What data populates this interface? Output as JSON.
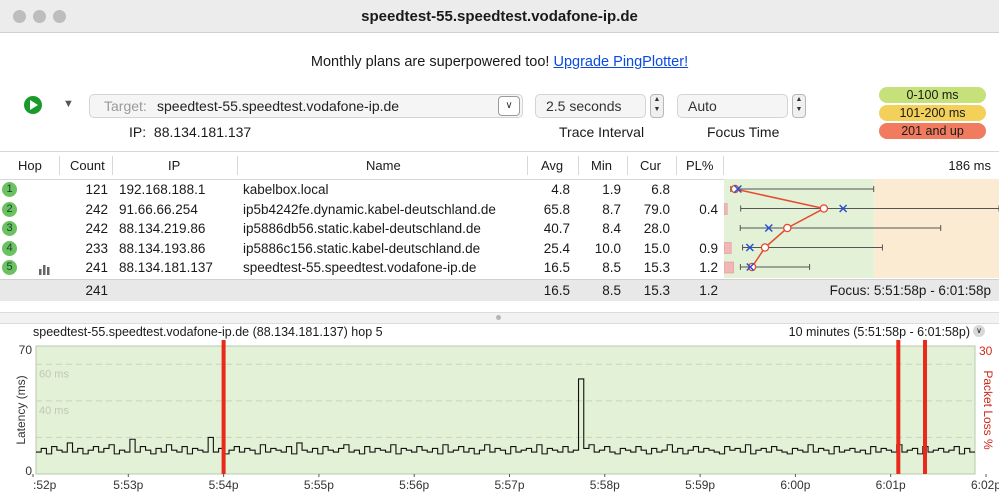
{
  "window": {
    "title": "speedtest-55.speedtest.vodafone-ip.de"
  },
  "promo": {
    "text": "Monthly plans are superpowered too!",
    "link": "Upgrade PingPlotter!"
  },
  "toolbar": {
    "target_label": "Target:",
    "target_value": "speedtest-55.speedtest.vodafone-ip.de",
    "ip_label": "IP:",
    "ip_value": "88.134.181.137",
    "trace_interval_value": "2.5 seconds",
    "trace_interval_label": "Trace Interval",
    "focus_time_value": "Auto",
    "focus_time_label": "Focus Time"
  },
  "legend": [
    {
      "label": "0-100 ms",
      "color": "#c6e07a"
    },
    {
      "label": "101-200 ms",
      "color": "#f3d05a"
    },
    {
      "label": "201 and up",
      "color": "#f07b5e"
    }
  ],
  "table": {
    "headers": {
      "hop": "Hop",
      "count": "Count",
      "ip": "IP",
      "name": "Name",
      "avg": "Avg",
      "min": "Min",
      "cur": "Cur",
      "pl": "PL%",
      "scale": "186 ms"
    },
    "rows": [
      {
        "hop": "1",
        "count": "121",
        "ip": "192.168.188.1",
        "name": "kabelbox.local",
        "avg": "4.8",
        "min": "1.9",
        "cur": "6.8",
        "pl": "",
        "min_ms": 1.9,
        "avg_ms": 4.8,
        "cur_ms": 6.8,
        "max_ms": 100,
        "pl_value": 0
      },
      {
        "hop": "2",
        "count": "242",
        "ip": "91.66.66.254",
        "name": "ip5b4242fe.dynamic.kabel-deutschland.de",
        "avg": "65.8",
        "min": "8.7",
        "cur": "79.0",
        "pl": "0.4",
        "min_ms": 8.7,
        "avg_ms": 65.8,
        "cur_ms": 79.0,
        "max_ms": 186,
        "pl_value": 0.4
      },
      {
        "hop": "3",
        "count": "242",
        "ip": "88.134.219.86",
        "name": "ip5886db56.static.kabel-deutschland.de",
        "avg": "40.7",
        "min": "8.4",
        "cur": "28.0",
        "pl": "",
        "min_ms": 8.4,
        "avg_ms": 40.7,
        "cur_ms": 28.0,
        "max_ms": 146,
        "pl_value": 0
      },
      {
        "hop": "4",
        "count": "233",
        "ip": "88.134.193.86",
        "name": "ip5886c156.static.kabel-deutschland.de",
        "avg": "25.4",
        "min": "10.0",
        "cur": "15.0",
        "pl": "0.9",
        "min_ms": 10.0,
        "avg_ms": 25.4,
        "cur_ms": 15.0,
        "max_ms": 106,
        "pl_value": 0.9
      },
      {
        "hop": "5",
        "count": "241",
        "ip": "88.134.181.137",
        "name": "speedtest-55.speedtest.vodafone-ip.de",
        "avg": "16.5",
        "min": "8.5",
        "cur": "15.3",
        "pl": "1.2",
        "min_ms": 8.5,
        "avg_ms": 16.5,
        "cur_ms": 15.3,
        "max_ms": 56,
        "pl_value": 1.2
      }
    ],
    "summary": {
      "count": "241",
      "avg": "16.5",
      "min": "8.5",
      "cur": "15.3",
      "pl": "1.2",
      "focus": "Focus: 5:51:58p - 6:01:58p"
    }
  },
  "graph": {
    "title": "speedtest-55.speedtest.vodafone-ip.de (88.134.181.137) hop 5",
    "range": "10 minutes (5:51:58p - 6:01:58p)",
    "chart_data": {
      "type": "line",
      "ylabel": "Latency (ms)",
      "y2label": "Packet Loss %",
      "ylim": [
        0,
        70
      ],
      "y2lim": [
        0,
        30
      ],
      "y_ticks": [
        "70",
        "0"
      ],
      "y2_ticks": [
        "30"
      ],
      "gridlines": [
        "60 ms",
        "40 ms"
      ],
      "x_ticks": [
        ":52p",
        "5:53p",
        "5:54p",
        "5:55p",
        "5:56p",
        "5:57p",
        "5:58p",
        "5:59p",
        "6:00p",
        "6:01p",
        "6:02p"
      ],
      "series": [
        {
          "values": [
            12,
            14,
            11,
            15,
            13,
            12,
            17,
            12,
            14,
            11,
            13,
            15,
            12,
            14,
            16,
            11,
            13,
            12,
            19,
            12,
            15,
            13,
            11,
            14,
            12,
            16,
            13,
            12,
            15,
            11,
            14,
            13,
            12,
            20,
            12,
            14,
            11,
            13,
            15,
            12,
            14,
            13,
            11,
            16,
            12,
            14,
            13,
            12,
            15,
            11,
            17,
            13,
            12,
            14,
            11,
            15,
            13,
            12,
            14,
            16,
            12,
            13,
            11,
            15,
            12,
            14,
            13,
            12,
            16,
            11,
            14,
            13,
            12,
            15,
            13,
            12,
            14,
            11,
            16,
            12,
            13,
            15,
            12,
            14,
            11,
            13,
            16,
            12,
            14,
            13,
            11,
            15,
            12,
            13,
            14,
            12,
            16,
            11,
            14,
            13,
            12,
            15,
            12,
            13,
            11,
            14,
            16,
            12,
            13,
            15,
            12,
            11,
            14,
            13,
            12,
            15,
            13,
            11,
            14,
            12,
            13,
            16,
            12,
            14,
            11,
            13,
            15,
            12,
            14,
            13,
            12,
            11,
            15,
            13,
            14,
            12,
            16,
            11,
            13,
            14,
            12,
            15,
            13,
            12,
            11,
            14,
            13,
            12,
            16,
            12,
            14,
            13,
            11,
            15,
            12,
            13,
            14,
            12,
            13,
            11,
            15,
            12,
            14,
            13,
            12,
            16,
            12,
            13,
            14,
            11,
            15,
            12,
            13,
            14,
            12,
            13,
            15,
            11,
            14,
            12
          ],
          "spike": {
            "index": 104,
            "value": 52
          }
        }
      ],
      "packet_loss_x": [
        2.0,
        9.08,
        9.36
      ]
    }
  }
}
